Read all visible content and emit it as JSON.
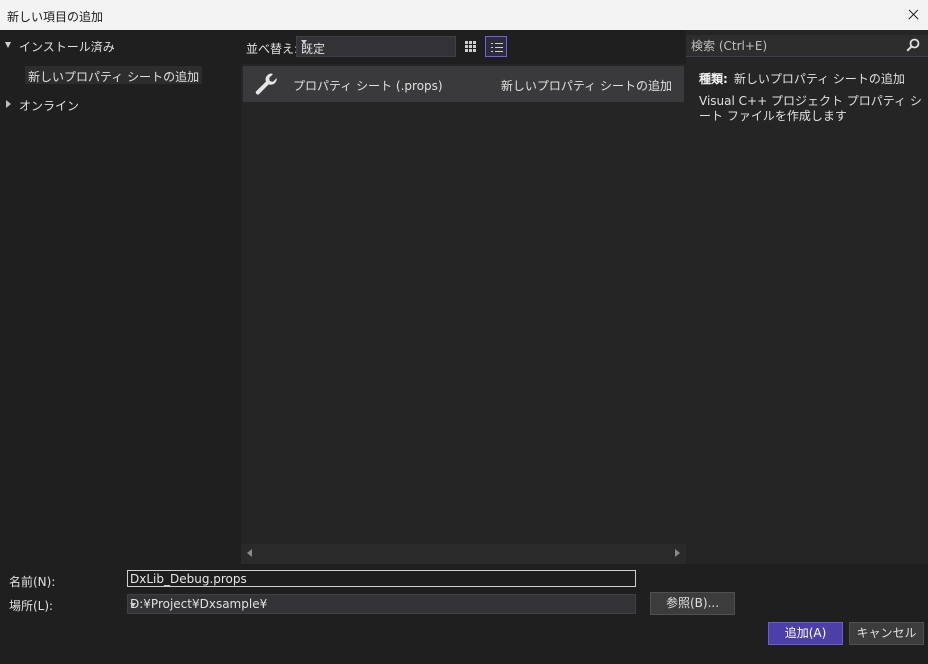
{
  "window": {
    "title": "新しい項目の追加"
  },
  "tree": {
    "installed": "インストール済み",
    "child": "新しいプロパティ シートの追加",
    "online": "オンライン"
  },
  "sort": {
    "label": "並べ替え:",
    "value": "既定"
  },
  "items": [
    {
      "name": "プロパティ シート (.props)",
      "type": "新しいプロパティ シートの追加",
      "icon": "wrench-icon"
    }
  ],
  "search": {
    "placeholder": "検索 (Ctrl+E)"
  },
  "details": {
    "type_label": "種類:",
    "type_value": "新しいプロパティ シートの追加",
    "description": "Visual C++ プロジェクト プロパティ シート ファイルを作成します"
  },
  "form": {
    "name_label": "名前(N):",
    "name_value": "DxLib_Debug.props",
    "location_label": "場所(L):",
    "location_value": "D:¥Project¥Dxsample¥",
    "browse_label": "参照(B)...",
    "add_label": "追加(A)",
    "cancel_label": "キャンセル"
  },
  "colors": {
    "accent": "#4d3fa8",
    "selected_item": "#3a3a3c",
    "background": "#1f1f1f"
  }
}
